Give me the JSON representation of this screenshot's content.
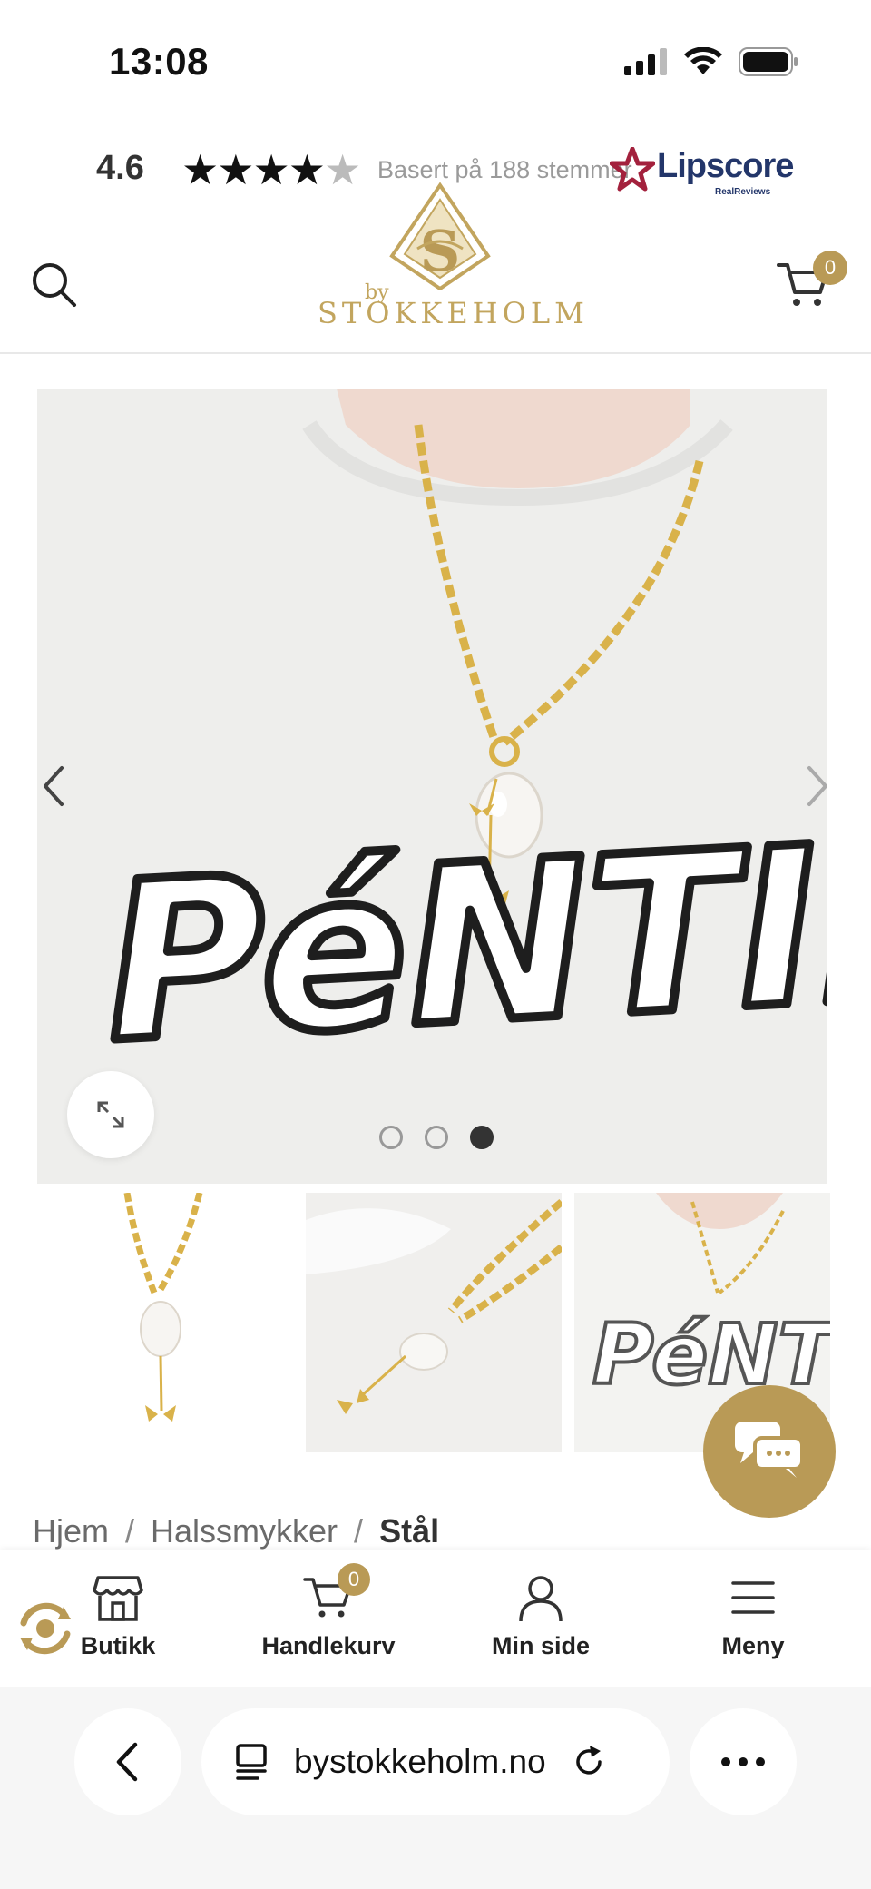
{
  "status_bar": {
    "time": "13:08"
  },
  "rating": {
    "score": "4.6",
    "stars": 4.6,
    "text": "Basert på 188 stemmer",
    "provider": "Lipscore",
    "provider_sub": "RealReviews"
  },
  "header": {
    "logo_by": "by",
    "logo_text": "STOKKEHOLM",
    "cart_count": "0",
    "brand_color": "#b99a56"
  },
  "product_image": {
    "slide_count": 3,
    "active_slide": 3,
    "shirt_print": "PéNTIDF"
  },
  "breadcrumb": {
    "items": [
      "Hjem",
      "Halssmykker"
    ],
    "current": "Stål",
    "separator": "/"
  },
  "bottom_nav": {
    "items": [
      {
        "label": "Butikk",
        "icon": "store-icon"
      },
      {
        "label": "Handlekurv",
        "icon": "cart-icon"
      },
      {
        "label": "Min side",
        "icon": "user-icon"
      },
      {
        "label": "Meny",
        "icon": "menu-icon"
      }
    ],
    "cart_count": "0"
  },
  "browser": {
    "url": "bystokkeholm.no"
  }
}
